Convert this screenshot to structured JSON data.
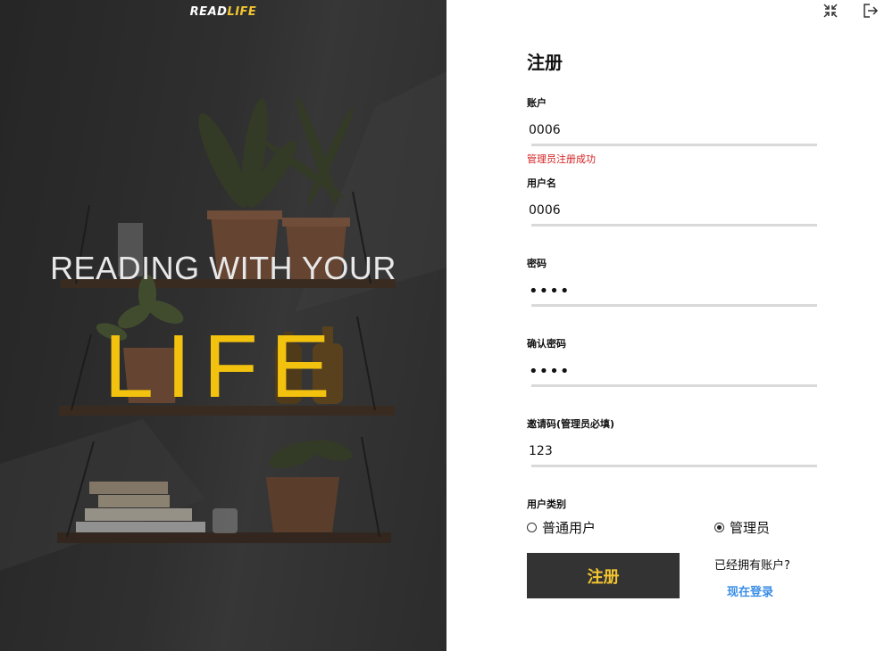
{
  "brand": {
    "part1": "READ",
    "part2": "LIFE"
  },
  "hero": {
    "tagline": "READING WITH YOUR",
    "highlight": "LIFE",
    "accent": "#f2c20f"
  },
  "window": {
    "minimize_icon": "collapse-icon",
    "exit_icon": "logout-icon"
  },
  "form": {
    "title": "注册",
    "account": {
      "label": "账户",
      "value": "0006",
      "message": "管理员注册成功"
    },
    "username": {
      "label": "用户名",
      "value": "0006"
    },
    "password": {
      "label": "密码",
      "value": "••••"
    },
    "confirm_password": {
      "label": "确认密码",
      "value": "••••"
    },
    "invite_code": {
      "label": "邀请码(管理员必填)",
      "value": "123"
    },
    "user_type": {
      "label": "用户类别",
      "options": [
        {
          "label": "普通用户",
          "selected": false
        },
        {
          "label": "管理员",
          "selected": true
        }
      ]
    },
    "submit_label": "注册",
    "has_account_text": "已经拥有账户?",
    "login_link": "现在登录",
    "colors": {
      "button_bg": "#333333",
      "button_text": "#f2c531",
      "link": "#3a8ee6",
      "error": "#d42020"
    }
  }
}
